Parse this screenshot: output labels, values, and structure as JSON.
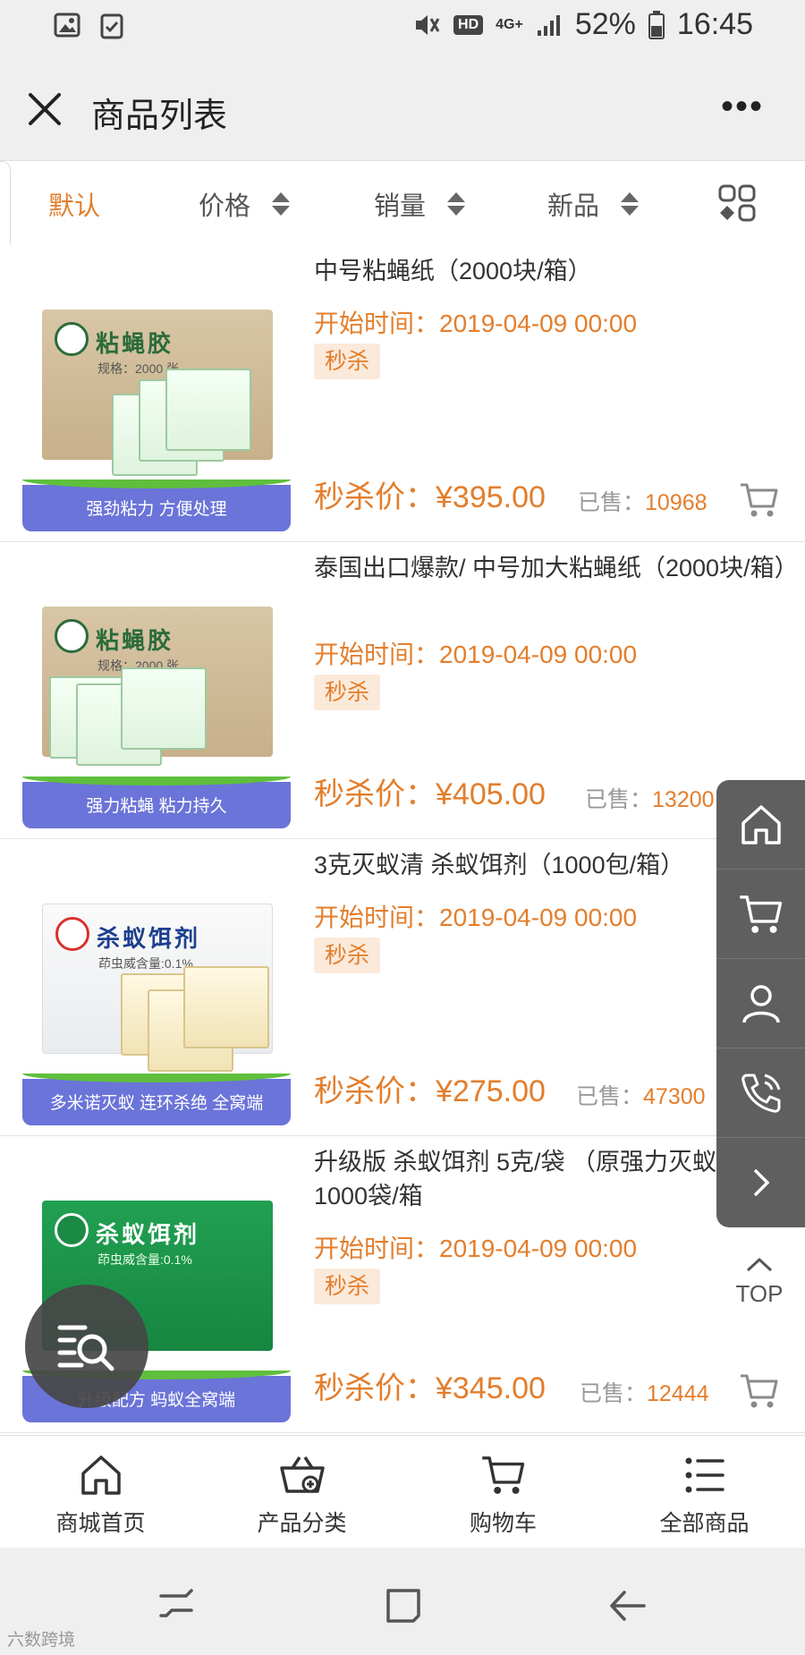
{
  "status_bar": {
    "network_badge": "HD",
    "network_type": "4G+",
    "battery": "52%",
    "time": "16:45"
  },
  "header": {
    "title": "商品列表",
    "more": "•••"
  },
  "sort_bar": {
    "default": "默认",
    "price": "价格",
    "sales": "销量",
    "new": "新品"
  },
  "products": [
    {
      "title": "中号粘蝇纸（2000块/箱）",
      "start_time": "开始时间：2019-04-09 00:00",
      "tag": "秒杀",
      "price": "秒杀价：¥395.00",
      "sold_label": "已售：",
      "sold_value": "10968",
      "box_text": "粘蝇胶",
      "box_sub": "规格：2000 张",
      "banner": "强劲粘力 方便处理"
    },
    {
      "title": "泰国出口爆款/ 中号加大粘蝇纸（2000块/箱）",
      "start_time": "开始时间：2019-04-09 00:00",
      "tag": "秒杀",
      "price": "秒杀价：¥405.00",
      "sold_label": "已售：",
      "sold_value": "13200",
      "box_text": "粘蝇胶",
      "box_sub": "规格：2000 张",
      "banner": "强力粘蝇 粘力持久"
    },
    {
      "title": "3克灭蚁清 杀蚁饵剂（1000包/箱）",
      "start_time": "开始时间：2019-04-09 00:00",
      "tag": "秒杀",
      "price": "秒杀价：¥275.00",
      "sold_label": "已售：",
      "sold_value": "47300",
      "box_text": "杀蚁饵剂",
      "box_sub": "茚虫威含量:0.1%",
      "banner": "多米诺灭蚁 连环杀绝 全窝端"
    },
    {
      "title": "升级版 杀蚁饵剂 5克/袋 （原强力灭蚁清）1000袋/箱",
      "start_time": "开始时间：2019-04-09 00:00",
      "tag": "秒杀",
      "price": "秒杀价：¥345.00",
      "sold_label": "已售：",
      "sold_value": "12444",
      "box_text": "杀蚁饵剂",
      "box_sub": "茚虫威含量:0.1%",
      "banner": "升级配方 蚂蚁全窝端"
    }
  ],
  "side_menu": {
    "items": [
      "home-icon",
      "cart-icon",
      "user-icon",
      "phone-icon",
      "chevron-right-icon"
    ],
    "top_label": "TOP"
  },
  "bottom_nav": {
    "home": "商城首页",
    "category": "产品分类",
    "cart": "购物车",
    "all": "全部商品"
  },
  "watermark": "六数跨境",
  "colors": {
    "accent": "#e37e2c",
    "tag_bg": "#fbe9da",
    "side_menu_bg": "#5f5f5f"
  }
}
